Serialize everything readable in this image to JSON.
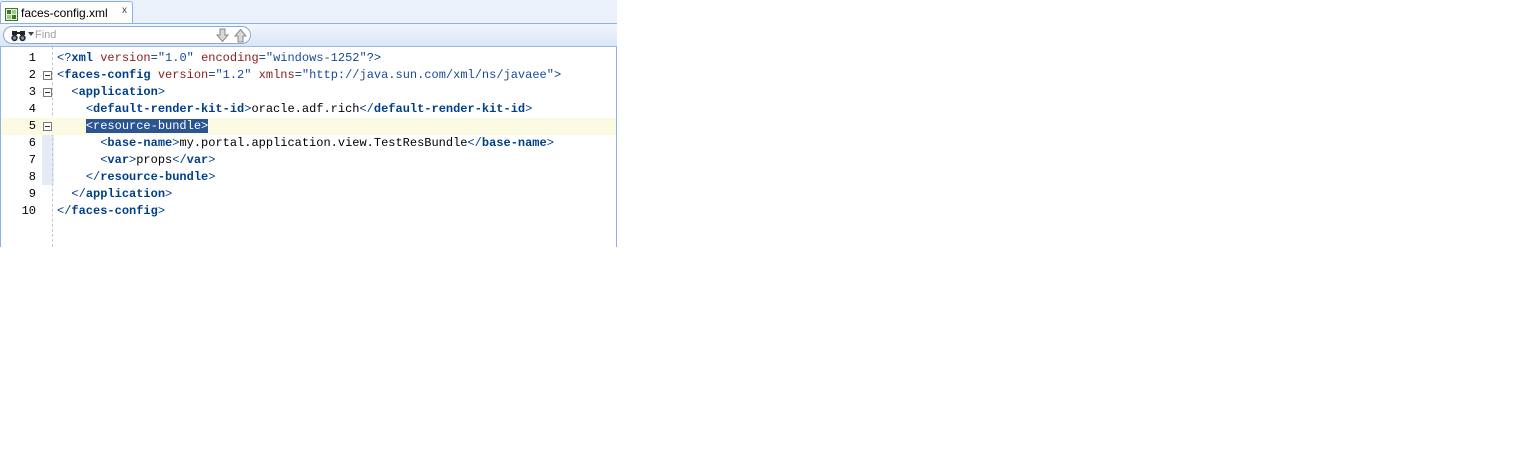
{
  "tab": {
    "title": "faces-config.xml",
    "close": "x",
    "icon": "xml-file-icon"
  },
  "find": {
    "placeholder": "Find",
    "search_icon": "binoculars-icon",
    "next_icon": "arrow-down-icon",
    "prev_icon": "arrow-up-icon"
  },
  "editor": {
    "current_line": 5,
    "lines": [
      {
        "n": "1",
        "fold": false,
        "t": [
          [
            "punc",
            "<?"
          ],
          [
            "tag",
            "xml"
          ],
          [
            "txt",
            " "
          ],
          [
            "attr",
            "version"
          ],
          [
            "punc",
            "="
          ],
          [
            "val",
            "\"1.0\""
          ],
          [
            "txt",
            " "
          ],
          [
            "attr",
            "encoding"
          ],
          [
            "punc",
            "="
          ],
          [
            "val",
            "\"windows-1252\""
          ],
          [
            "punc",
            "?>"
          ]
        ]
      },
      {
        "n": "2",
        "fold": true,
        "t": [
          [
            "punc",
            "<"
          ],
          [
            "tag",
            "faces-config"
          ],
          [
            "txt",
            " "
          ],
          [
            "attr",
            "version"
          ],
          [
            "punc",
            "="
          ],
          [
            "val",
            "\"1.2\""
          ],
          [
            "txt",
            " "
          ],
          [
            "attr",
            "xmlns"
          ],
          [
            "punc",
            "="
          ],
          [
            "val",
            "\"http://java.sun.com/xml/ns/javaee\""
          ],
          [
            "punc",
            ">"
          ]
        ]
      },
      {
        "n": "3",
        "fold": true,
        "t": [
          [
            "txt",
            "  "
          ],
          [
            "punc",
            "<"
          ],
          [
            "tag",
            "application"
          ],
          [
            "punc",
            ">"
          ]
        ]
      },
      {
        "n": "4",
        "fold": false,
        "t": [
          [
            "txt",
            "    "
          ],
          [
            "punc",
            "<"
          ],
          [
            "tag",
            "default-render-kit-id"
          ],
          [
            "punc",
            ">"
          ],
          [
            "txt",
            "oracle.adf.rich"
          ],
          [
            "punc",
            "</"
          ],
          [
            "tag",
            "default-render-kit-id"
          ],
          [
            "punc",
            ">"
          ]
        ]
      },
      {
        "n": "5",
        "fold": true,
        "t": [
          [
            "txt",
            "    "
          ],
          [
            "sel",
            "<resource-bundle>"
          ]
        ]
      },
      {
        "n": "6",
        "fold": false,
        "t": [
          [
            "txt",
            "      "
          ],
          [
            "punc",
            "<"
          ],
          [
            "tag",
            "base-name"
          ],
          [
            "punc",
            ">"
          ],
          [
            "txt",
            "my.portal.application.view.TestResBundle"
          ],
          [
            "punc",
            "</"
          ],
          [
            "tag",
            "base-name"
          ],
          [
            "punc",
            ">"
          ]
        ]
      },
      {
        "n": "7",
        "fold": false,
        "t": [
          [
            "txt",
            "      "
          ],
          [
            "punc",
            "<"
          ],
          [
            "tag",
            "var"
          ],
          [
            "punc",
            ">"
          ],
          [
            "txt",
            "props"
          ],
          [
            "punc",
            "</"
          ],
          [
            "tag",
            "var"
          ],
          [
            "punc",
            ">"
          ]
        ]
      },
      {
        "n": "8",
        "fold": false,
        "t": [
          [
            "txt",
            "    "
          ],
          [
            "punc",
            "</"
          ],
          [
            "tag",
            "resource-bundle"
          ],
          [
            "punc",
            ">"
          ]
        ]
      },
      {
        "n": "9",
        "fold": false,
        "t": [
          [
            "txt",
            "  "
          ],
          [
            "punc",
            "</"
          ],
          [
            "tag",
            "application"
          ],
          [
            "punc",
            ">"
          ]
        ]
      },
      {
        "n": "10",
        "fold": false,
        "t": [
          [
            "punc",
            "</"
          ],
          [
            "tag",
            "faces-config"
          ],
          [
            "punc",
            ">"
          ]
        ]
      }
    ]
  },
  "colors": {
    "tag": "#003f88",
    "attribute": "#8a1c1c",
    "value": "#1a4a9a",
    "selection": "#2b5492",
    "current_line": "#fbfbe3"
  }
}
